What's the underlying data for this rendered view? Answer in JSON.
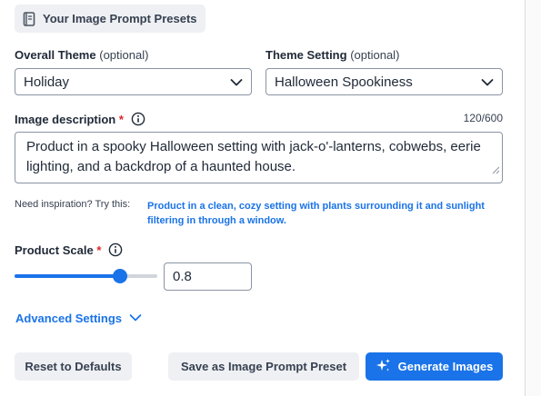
{
  "presets": {
    "label": "Your Image Prompt Presets",
    "icon": "book-icon"
  },
  "theme": {
    "label": "Overall Theme",
    "optional": "(optional)",
    "value": "Holiday"
  },
  "theme_setting": {
    "label": "Theme Setting",
    "optional": "(optional)",
    "value": "Halloween Spookiness"
  },
  "description": {
    "label": "Image description",
    "required_mark": "*",
    "counter": "120/600",
    "value": "Product in a spooky Halloween setting with jack-o'-lanterns, cobwebs, eerie lighting, and a backdrop of a haunted house."
  },
  "inspiration": {
    "label": "Need inspiration? Try this:",
    "suggestion": "Product in a clean, cozy setting with plants surrounding it and sunlight filtering in through a window."
  },
  "scale": {
    "label": "Product Scale",
    "required_mark": "*",
    "value": "0.8",
    "slider_fraction": 0.74
  },
  "advanced": {
    "label": "Advanced Settings"
  },
  "actions": {
    "reset": "Reset to Defaults",
    "save_preset": "Save as Image Prompt Preset",
    "generate": "Generate Images"
  },
  "colors": {
    "accent": "#1a73e8",
    "required": "#dc2626",
    "button_gray": "#eef0f3"
  }
}
